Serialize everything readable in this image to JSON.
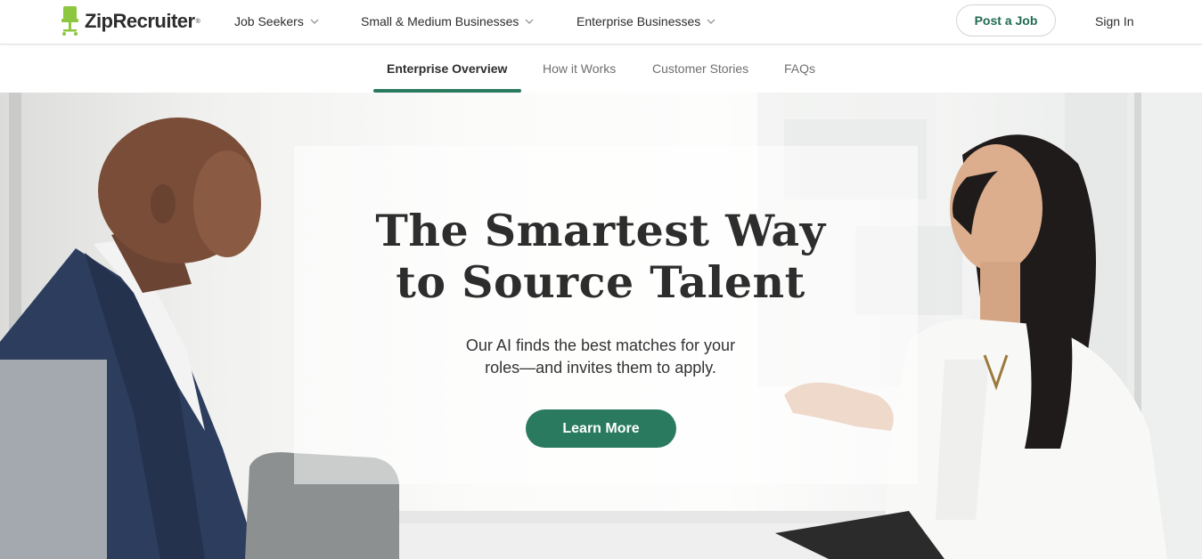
{
  "brand": {
    "name": "ZipRecruiter",
    "registered_mark": "®",
    "accent_color": "#2a7a5f",
    "logo_color": "#8dc63f"
  },
  "topnav": {
    "items": [
      {
        "label": "Job Seekers",
        "icon": "chevron-down-icon"
      },
      {
        "label": "Small & Medium Businesses",
        "icon": "chevron-down-icon"
      },
      {
        "label": "Enterprise Businesses",
        "icon": "chevron-down-icon"
      }
    ],
    "post_job_label": "Post a Job",
    "sign_in_label": "Sign In"
  },
  "subnav": {
    "tabs": [
      {
        "label": "Enterprise Overview",
        "active": true
      },
      {
        "label": "How it Works",
        "active": false
      },
      {
        "label": "Customer Stories",
        "active": false
      },
      {
        "label": "FAQs",
        "active": false
      }
    ]
  },
  "hero": {
    "title_line1": "The Smartest Way",
    "title_line2": "to Source Talent",
    "subtitle_line1": "Our AI finds the best matches for your",
    "subtitle_line2": "roles—and invites them to apply.",
    "cta_label": "Learn More"
  }
}
